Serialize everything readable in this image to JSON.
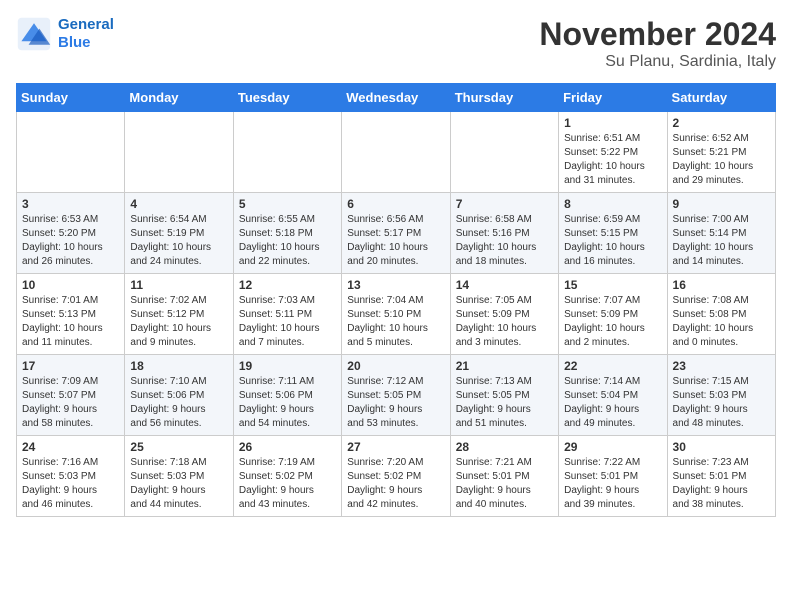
{
  "header": {
    "logo_line1": "General",
    "logo_line2": "Blue",
    "month": "November 2024",
    "location": "Su Planu, Sardinia, Italy"
  },
  "weekdays": [
    "Sunday",
    "Monday",
    "Tuesday",
    "Wednesday",
    "Thursday",
    "Friday",
    "Saturday"
  ],
  "weeks": [
    [
      {
        "day": "",
        "info": ""
      },
      {
        "day": "",
        "info": ""
      },
      {
        "day": "",
        "info": ""
      },
      {
        "day": "",
        "info": ""
      },
      {
        "day": "",
        "info": ""
      },
      {
        "day": "1",
        "info": "Sunrise: 6:51 AM\nSunset: 5:22 PM\nDaylight: 10 hours\nand 31 minutes."
      },
      {
        "day": "2",
        "info": "Sunrise: 6:52 AM\nSunset: 5:21 PM\nDaylight: 10 hours\nand 29 minutes."
      }
    ],
    [
      {
        "day": "3",
        "info": "Sunrise: 6:53 AM\nSunset: 5:20 PM\nDaylight: 10 hours\nand 26 minutes."
      },
      {
        "day": "4",
        "info": "Sunrise: 6:54 AM\nSunset: 5:19 PM\nDaylight: 10 hours\nand 24 minutes."
      },
      {
        "day": "5",
        "info": "Sunrise: 6:55 AM\nSunset: 5:18 PM\nDaylight: 10 hours\nand 22 minutes."
      },
      {
        "day": "6",
        "info": "Sunrise: 6:56 AM\nSunset: 5:17 PM\nDaylight: 10 hours\nand 20 minutes."
      },
      {
        "day": "7",
        "info": "Sunrise: 6:58 AM\nSunset: 5:16 PM\nDaylight: 10 hours\nand 18 minutes."
      },
      {
        "day": "8",
        "info": "Sunrise: 6:59 AM\nSunset: 5:15 PM\nDaylight: 10 hours\nand 16 minutes."
      },
      {
        "day": "9",
        "info": "Sunrise: 7:00 AM\nSunset: 5:14 PM\nDaylight: 10 hours\nand 14 minutes."
      }
    ],
    [
      {
        "day": "10",
        "info": "Sunrise: 7:01 AM\nSunset: 5:13 PM\nDaylight: 10 hours\nand 11 minutes."
      },
      {
        "day": "11",
        "info": "Sunrise: 7:02 AM\nSunset: 5:12 PM\nDaylight: 10 hours\nand 9 minutes."
      },
      {
        "day": "12",
        "info": "Sunrise: 7:03 AM\nSunset: 5:11 PM\nDaylight: 10 hours\nand 7 minutes."
      },
      {
        "day": "13",
        "info": "Sunrise: 7:04 AM\nSunset: 5:10 PM\nDaylight: 10 hours\nand 5 minutes."
      },
      {
        "day": "14",
        "info": "Sunrise: 7:05 AM\nSunset: 5:09 PM\nDaylight: 10 hours\nand 3 minutes."
      },
      {
        "day": "15",
        "info": "Sunrise: 7:07 AM\nSunset: 5:09 PM\nDaylight: 10 hours\nand 2 minutes."
      },
      {
        "day": "16",
        "info": "Sunrise: 7:08 AM\nSunset: 5:08 PM\nDaylight: 10 hours\nand 0 minutes."
      }
    ],
    [
      {
        "day": "17",
        "info": "Sunrise: 7:09 AM\nSunset: 5:07 PM\nDaylight: 9 hours\nand 58 minutes."
      },
      {
        "day": "18",
        "info": "Sunrise: 7:10 AM\nSunset: 5:06 PM\nDaylight: 9 hours\nand 56 minutes."
      },
      {
        "day": "19",
        "info": "Sunrise: 7:11 AM\nSunset: 5:06 PM\nDaylight: 9 hours\nand 54 minutes."
      },
      {
        "day": "20",
        "info": "Sunrise: 7:12 AM\nSunset: 5:05 PM\nDaylight: 9 hours\nand 53 minutes."
      },
      {
        "day": "21",
        "info": "Sunrise: 7:13 AM\nSunset: 5:05 PM\nDaylight: 9 hours\nand 51 minutes."
      },
      {
        "day": "22",
        "info": "Sunrise: 7:14 AM\nSunset: 5:04 PM\nDaylight: 9 hours\nand 49 minutes."
      },
      {
        "day": "23",
        "info": "Sunrise: 7:15 AM\nSunset: 5:03 PM\nDaylight: 9 hours\nand 48 minutes."
      }
    ],
    [
      {
        "day": "24",
        "info": "Sunrise: 7:16 AM\nSunset: 5:03 PM\nDaylight: 9 hours\nand 46 minutes."
      },
      {
        "day": "25",
        "info": "Sunrise: 7:18 AM\nSunset: 5:03 PM\nDaylight: 9 hours\nand 44 minutes."
      },
      {
        "day": "26",
        "info": "Sunrise: 7:19 AM\nSunset: 5:02 PM\nDaylight: 9 hours\nand 43 minutes."
      },
      {
        "day": "27",
        "info": "Sunrise: 7:20 AM\nSunset: 5:02 PM\nDaylight: 9 hours\nand 42 minutes."
      },
      {
        "day": "28",
        "info": "Sunrise: 7:21 AM\nSunset: 5:01 PM\nDaylight: 9 hours\nand 40 minutes."
      },
      {
        "day": "29",
        "info": "Sunrise: 7:22 AM\nSunset: 5:01 PM\nDaylight: 9 hours\nand 39 minutes."
      },
      {
        "day": "30",
        "info": "Sunrise: 7:23 AM\nSunset: 5:01 PM\nDaylight: 9 hours\nand 38 minutes."
      }
    ]
  ]
}
